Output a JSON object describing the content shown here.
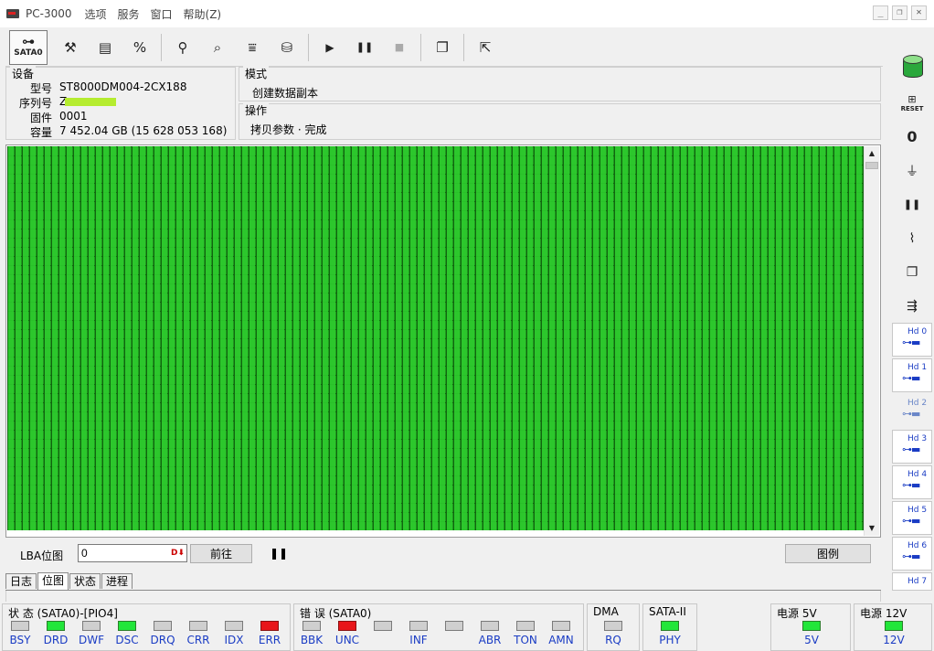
{
  "window": {
    "title": "PC-3000",
    "menu": [
      "选项",
      "服务",
      "窗口",
      "帮助(Z)"
    ],
    "controls": [
      "_",
      "❐",
      "✕"
    ]
  },
  "toolbar": {
    "sata_label": "SATA0",
    "buttons": [
      {
        "name": "tools-icon",
        "glyph": "⚒"
      },
      {
        "name": "disk-map-icon",
        "glyph": "▤"
      },
      {
        "name": "percent-icon",
        "glyph": "%"
      },
      {
        "name": "tree-icon",
        "glyph": "⚲"
      },
      {
        "name": "binoculars-icon",
        "glyph": "⌕"
      },
      {
        "name": "merge-icon",
        "glyph": "⩸"
      },
      {
        "name": "hdd-icon",
        "glyph": "⛁"
      },
      {
        "name": "play-icon",
        "glyph": "▶"
      },
      {
        "name": "pause-icon",
        "glyph": "❚❚"
      },
      {
        "name": "stop-icon",
        "glyph": "■"
      },
      {
        "name": "copy-windows-icon",
        "glyph": "❐"
      },
      {
        "name": "exit-icon",
        "glyph": "⇱"
      }
    ]
  },
  "device": {
    "legend": "设备",
    "model_key": "型号",
    "model": "ST8000DM004-2CX188",
    "serial_key": "序列号",
    "serial_prefix": "Z",
    "firmware_key": "固件",
    "firmware": "0001",
    "capacity_key": "容量",
    "capacity": "7 452.04 GB (15 628 053 168)"
  },
  "mode": {
    "legend": "模式",
    "value": "创建数据副本"
  },
  "operation": {
    "legend": "操作",
    "value": "拷贝参数 · 完成"
  },
  "lba": {
    "label": "LBA位图",
    "value": "0",
    "dec_badge": "D⬇",
    "go_label": "前往",
    "pause_glyph": "❚❚",
    "legend_label": "图例"
  },
  "tabs": [
    "日志",
    "位图",
    "状态",
    "进程"
  ],
  "active_tab": 1,
  "right_toolbar": {
    "reset_label": "RESET",
    "zero_label": "0",
    "hd_heads": [
      "Hd 0",
      "Hd 1",
      "Hd 2",
      "Hd 3",
      "Hd 4",
      "Hd 5",
      "Hd 6",
      "Hd 7"
    ]
  },
  "status": {
    "state_title": "状 态 (SATA0)-[PIO4]",
    "state_leds": [
      {
        "label": "BSY",
        "state": "off"
      },
      {
        "label": "DRD",
        "state": "green"
      },
      {
        "label": "DWF",
        "state": "off"
      },
      {
        "label": "DSC",
        "state": "green"
      },
      {
        "label": "DRQ",
        "state": "off"
      },
      {
        "label": "CRR",
        "state": "off"
      },
      {
        "label": "IDX",
        "state": "off"
      },
      {
        "label": "ERR",
        "state": "red"
      }
    ],
    "error_title": "错 误 (SATA0)",
    "error_leds": [
      {
        "label": "BBK",
        "state": "off"
      },
      {
        "label": "UNC",
        "state": "red"
      },
      {
        "label": "",
        "state": "off"
      },
      {
        "label": "INF",
        "state": "off"
      },
      {
        "label": "",
        "state": "off"
      },
      {
        "label": "ABR",
        "state": "off"
      },
      {
        "label": "TON",
        "state": "off"
      },
      {
        "label": "AMN",
        "state": "off"
      }
    ],
    "dma_title": "DMA",
    "dma_led": {
      "label": "RQ",
      "state": "off"
    },
    "sata_title": "SATA-II",
    "sata_led": {
      "label": "PHY",
      "state": "green"
    },
    "power5_title": "电源 5V",
    "power5_led": {
      "label": "5V",
      "state": "green"
    },
    "power12_title": "电源 12V",
    "power12_led": {
      "label": "12V",
      "state": "green"
    }
  },
  "colors": {
    "led_green": "#22e63a",
    "led_red": "#e8161a",
    "bitmap_green": "#2fd02f",
    "label_blue": "#1a3cc4"
  }
}
